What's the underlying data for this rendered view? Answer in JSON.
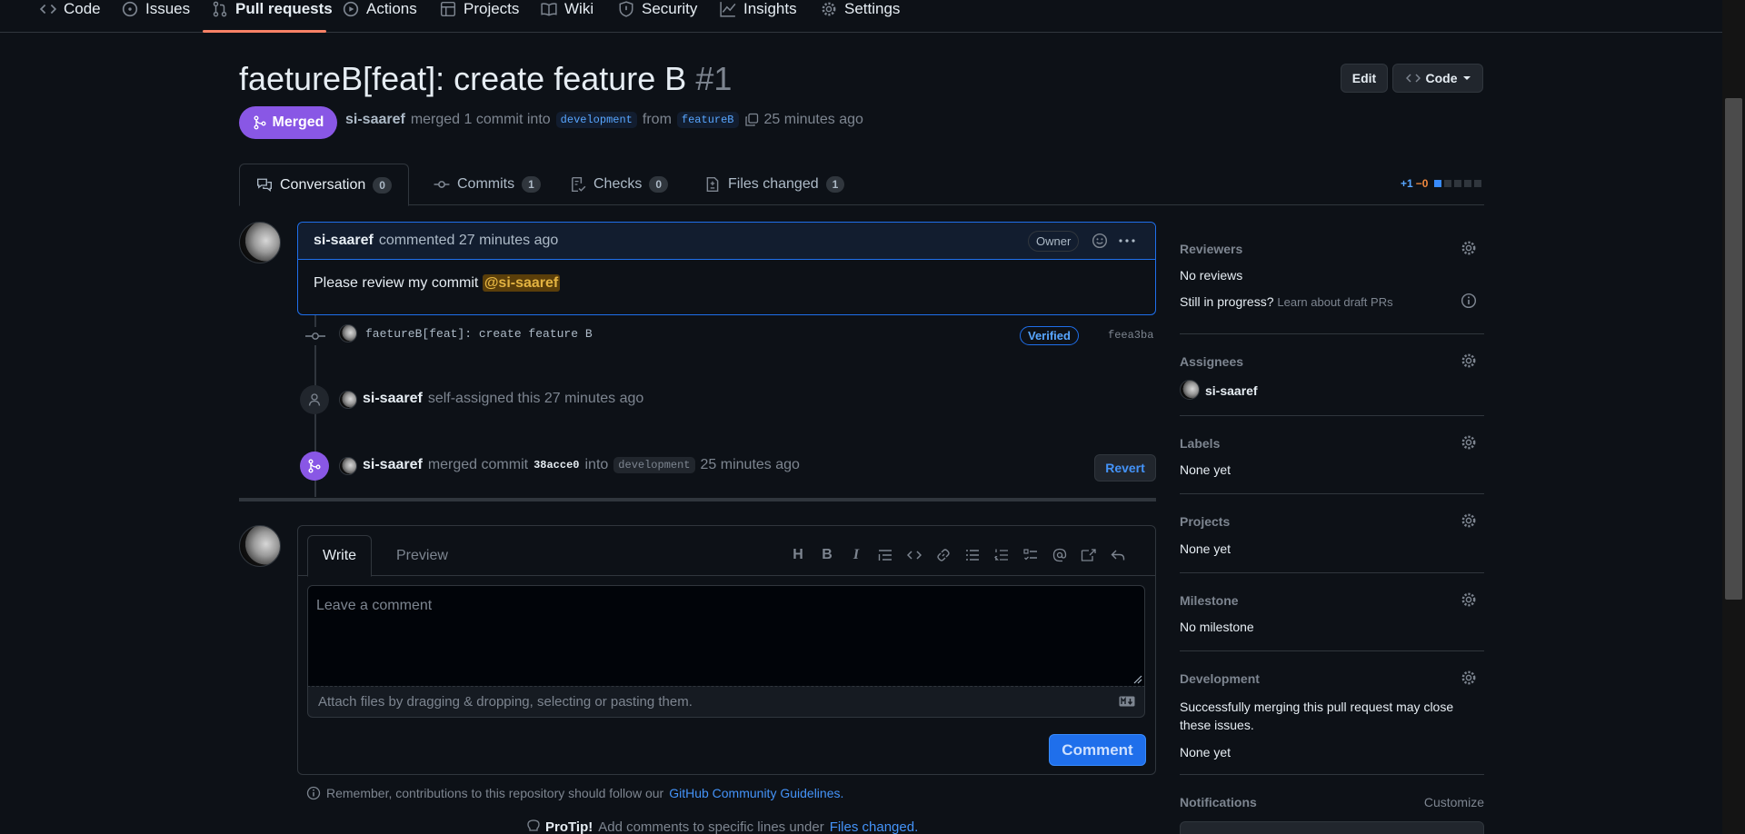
{
  "repo_nav": {
    "items": [
      {
        "label": "Code",
        "icon": "code-icon"
      },
      {
        "label": "Issues",
        "icon": "issue-icon"
      },
      {
        "label": "Pull requests",
        "icon": "pull-request-icon"
      },
      {
        "label": "Actions",
        "icon": "play-icon"
      },
      {
        "label": "Projects",
        "icon": "table-icon"
      },
      {
        "label": "Wiki",
        "icon": "book-icon"
      },
      {
        "label": "Security",
        "icon": "shield-icon"
      },
      {
        "label": "Insights",
        "icon": "graph-icon"
      },
      {
        "label": "Settings",
        "icon": "gear-icon"
      }
    ],
    "active": "Pull requests"
  },
  "header": {
    "title": "faetureB[feat]: create feature B",
    "number": "#1",
    "edit_label": "Edit",
    "code_label": "Code",
    "state_label": "Merged",
    "author": "si-saaref",
    "merge_text": "merged 1 commit into",
    "base_branch": "development",
    "from_text": "from",
    "head_branch": "featureB",
    "time_ago": "25 minutes ago"
  },
  "tabs": [
    {
      "label": "Conversation",
      "count": "0"
    },
    {
      "label": "Commits",
      "count": "1"
    },
    {
      "label": "Checks",
      "count": "0"
    },
    {
      "label": "Files changed",
      "count": "1"
    }
  ],
  "diffstat": {
    "additions": "+1",
    "deletions": "−0"
  },
  "comment": {
    "author": "si-saaref",
    "action": "commented 27 minutes ago",
    "role": "Owner",
    "body": "Please review my commit",
    "mention": "@si-saaref"
  },
  "timeline": {
    "commit_message": "faetureB[feat]: create feature B",
    "commit_verified": "Verified",
    "commit_sha": "feea3ba",
    "assign_user": "si-saaref",
    "assign_text": "self-assigned this 27 minutes ago",
    "merge_user": "si-saaref",
    "merge_text": "merged commit",
    "merge_sha": "38acce0",
    "merge_into": "into",
    "merge_branch": "development",
    "merge_time": "25 minutes ago",
    "revert_label": "Revert"
  },
  "composer": {
    "write_tab": "Write",
    "preview_tab": "Preview",
    "placeholder": "Leave a comment",
    "attach_text": "Attach files by dragging & dropping, selecting or pasting them.",
    "submit_label": "Comment",
    "remember_text": "Remember, contributions to this repository should follow our",
    "guidelines_link": "GitHub Community Guidelines.",
    "protip_label": "ProTip!",
    "protip_text": "Add comments to specific lines under",
    "protip_link": "Files changed."
  },
  "sidebar": {
    "reviewers_title": "Reviewers",
    "reviewers_value": "No reviews",
    "draft_question": "Still in progress?",
    "draft_link": "Learn about draft PRs",
    "assignees_title": "Assignees",
    "assignee": "si-saaref",
    "labels_title": "Labels",
    "labels_value": "None yet",
    "projects_title": "Projects",
    "projects_value": "None yet",
    "milestone_title": "Milestone",
    "milestone_value": "No milestone",
    "development_title": "Development",
    "development_text": "Successfully merging this pull request may close these issues.",
    "development_value": "None yet",
    "notifications_title": "Notifications",
    "customize_label": "Customize"
  }
}
